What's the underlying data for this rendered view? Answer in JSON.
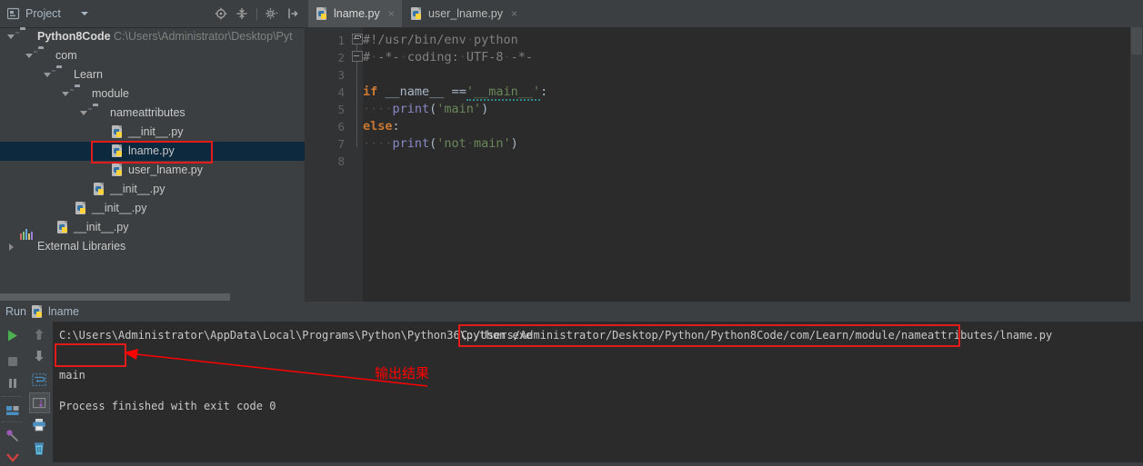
{
  "project_panel": {
    "title": "Project",
    "icon": "project-icon",
    "dropdown_icon": "chevron-down-icon",
    "toolbar": [
      {
        "name": "locate-target-icon",
        "label": "Select Opened File"
      },
      {
        "name": "collapse-all-icon",
        "label": "Collapse All"
      },
      {
        "name": "gear-icon",
        "label": "Settings"
      },
      {
        "name": "hide-panel-icon",
        "label": "Hide"
      }
    ],
    "tree": [
      {
        "depth": 0,
        "label": "Python8Code",
        "path": "C:\\Users\\Administrator\\Desktop\\Pyt",
        "icon": "folder-icon",
        "expanded": true,
        "bold": true,
        "selected": false
      },
      {
        "depth": 1,
        "label": "com",
        "path": "",
        "icon": "folder-icon",
        "expanded": true,
        "bold": false,
        "selected": false
      },
      {
        "depth": 2,
        "label": "Learn",
        "path": "",
        "icon": "folder-icon",
        "expanded": true,
        "bold": false,
        "selected": false
      },
      {
        "depth": 3,
        "label": "module",
        "path": "",
        "icon": "folder-icon",
        "expanded": true,
        "bold": false,
        "selected": false
      },
      {
        "depth": 4,
        "label": "nameattributes",
        "path": "",
        "icon": "folder-icon",
        "expanded": true,
        "bold": false,
        "selected": false
      },
      {
        "depth": 5,
        "label": "__init__.py",
        "path": "",
        "icon": "python-file-icon",
        "expanded": null,
        "bold": false,
        "selected": false
      },
      {
        "depth": 5,
        "label": "lname.py",
        "path": "",
        "icon": "python-file-icon",
        "expanded": null,
        "bold": false,
        "selected": true
      },
      {
        "depth": 5,
        "label": "user_lname.py",
        "path": "",
        "icon": "python-file-icon",
        "expanded": null,
        "bold": false,
        "selected": false
      },
      {
        "depth": 4,
        "label": "__init__.py",
        "path": "",
        "icon": "python-file-icon",
        "expanded": null,
        "bold": false,
        "selected": false
      },
      {
        "depth": 3,
        "label": "__init__.py",
        "path": "",
        "icon": "python-file-icon",
        "expanded": null,
        "bold": false,
        "selected": false
      },
      {
        "depth": 2,
        "label": "__init__.py",
        "path": "",
        "icon": "python-file-icon",
        "expanded": null,
        "bold": false,
        "selected": false
      },
      {
        "depth": 0,
        "label": "External Libraries",
        "path": "",
        "icon": "external-libraries-icon",
        "expanded": false,
        "bold": false,
        "selected": false
      }
    ]
  },
  "editor": {
    "tabs": [
      {
        "label": "lname.py",
        "icon": "python-file-icon",
        "active": true,
        "close_glyph": "×"
      },
      {
        "label": "user_lname.py",
        "icon": "python-file-icon",
        "active": false,
        "close_glyph": "×"
      }
    ],
    "line_numbers": [
      "1",
      "2",
      "3",
      "4",
      "5",
      "6",
      "7",
      "8"
    ],
    "lines": [
      {
        "n": 1,
        "segments": [
          {
            "t": "#!/usr/bin/env",
            "c": "c"
          },
          {
            "t": "·",
            "c": "dot"
          },
          {
            "t": "python",
            "c": "c"
          }
        ]
      },
      {
        "n": 2,
        "segments": [
          {
            "t": "#",
            "c": "c"
          },
          {
            "t": "·",
            "c": "dot"
          },
          {
            "t": "-*-",
            "c": "c"
          },
          {
            "t": "·",
            "c": "dot"
          },
          {
            "t": "coding:",
            "c": "c"
          },
          {
            "t": "·",
            "c": "dot"
          },
          {
            "t": "UTF-8",
            "c": "c"
          },
          {
            "t": "·",
            "c": "dot"
          },
          {
            "t": "-*-",
            "c": "c"
          }
        ]
      },
      {
        "n": 3,
        "segments": []
      },
      {
        "n": 4,
        "segments": [
          {
            "t": "if",
            "c": "k"
          },
          {
            "t": " ",
            "c": "n"
          },
          {
            "t": "__name__",
            "c": "n"
          },
          {
            "t": " ",
            "c": "n"
          },
          {
            "t": "==",
            "c": "n"
          },
          {
            "t": "'__main__'",
            "c": "s wavy"
          },
          {
            "t": ":",
            "c": "n"
          }
        ]
      },
      {
        "n": 5,
        "segments": [
          {
            "t": "····",
            "c": "dot"
          },
          {
            "t": "print",
            "c": "f"
          },
          {
            "t": "(",
            "c": "n"
          },
          {
            "t": "'main'",
            "c": "s"
          },
          {
            "t": ")",
            "c": "n"
          }
        ]
      },
      {
        "n": 6,
        "segments": [
          {
            "t": "else",
            "c": "k"
          },
          {
            "t": ":",
            "c": "n"
          }
        ]
      },
      {
        "n": 7,
        "segments": [
          {
            "t": "····",
            "c": "dot"
          },
          {
            "t": "print",
            "c": "f"
          },
          {
            "t": "(",
            "c": "n"
          },
          {
            "t": "'not",
            "c": "s"
          },
          {
            "t": "·",
            "c": "dot"
          },
          {
            "t": "main'",
            "c": "s"
          },
          {
            "t": ")",
            "c": "n"
          }
        ]
      },
      {
        "n": 8,
        "segments": []
      }
    ]
  },
  "run_panel": {
    "title": "Run",
    "config_name": "lname",
    "config_icon": "python-file-icon",
    "toolbar_left": [
      {
        "name": "run-button",
        "label": "Rerun"
      },
      {
        "name": "stop-button",
        "label": "Stop"
      },
      {
        "name": "pause-button",
        "label": "Pause Output"
      },
      {
        "name": "layout-button",
        "label": "Layout"
      },
      {
        "name": "pin-button",
        "label": "Pin Tab"
      },
      {
        "name": "close-button",
        "label": "Close"
      }
    ],
    "toolbar_right": [
      {
        "name": "up-arrow-icon",
        "label": "Up the Stack Trace"
      },
      {
        "name": "down-arrow-icon",
        "label": "Down the Stack Trace"
      },
      {
        "name": "soft-wrap-icon",
        "label": "Use Soft Wraps"
      },
      {
        "name": "scroll-to-end-icon",
        "label": "Scroll to End"
      },
      {
        "name": "print-icon",
        "label": "Print"
      },
      {
        "name": "trash-icon",
        "label": "Clear All"
      }
    ],
    "console": {
      "interpreter_path": "C:\\Users\\Administrator\\AppData\\Local\\Programs\\Python\\Python36\\python.exe",
      "script_path": "C:/Users/Administrator/Desktop/Python/Python8Code/com/Learn/module/nameattributes/lname.py",
      "output": "main",
      "exit_line": "Process finished with exit code 0"
    }
  },
  "annotations": {
    "color": "#ff0000",
    "label": "输出结果",
    "boxes": [
      "tree-lname-box",
      "script-path-box",
      "console-output-box"
    ],
    "arrow": "arrow-to-output"
  }
}
